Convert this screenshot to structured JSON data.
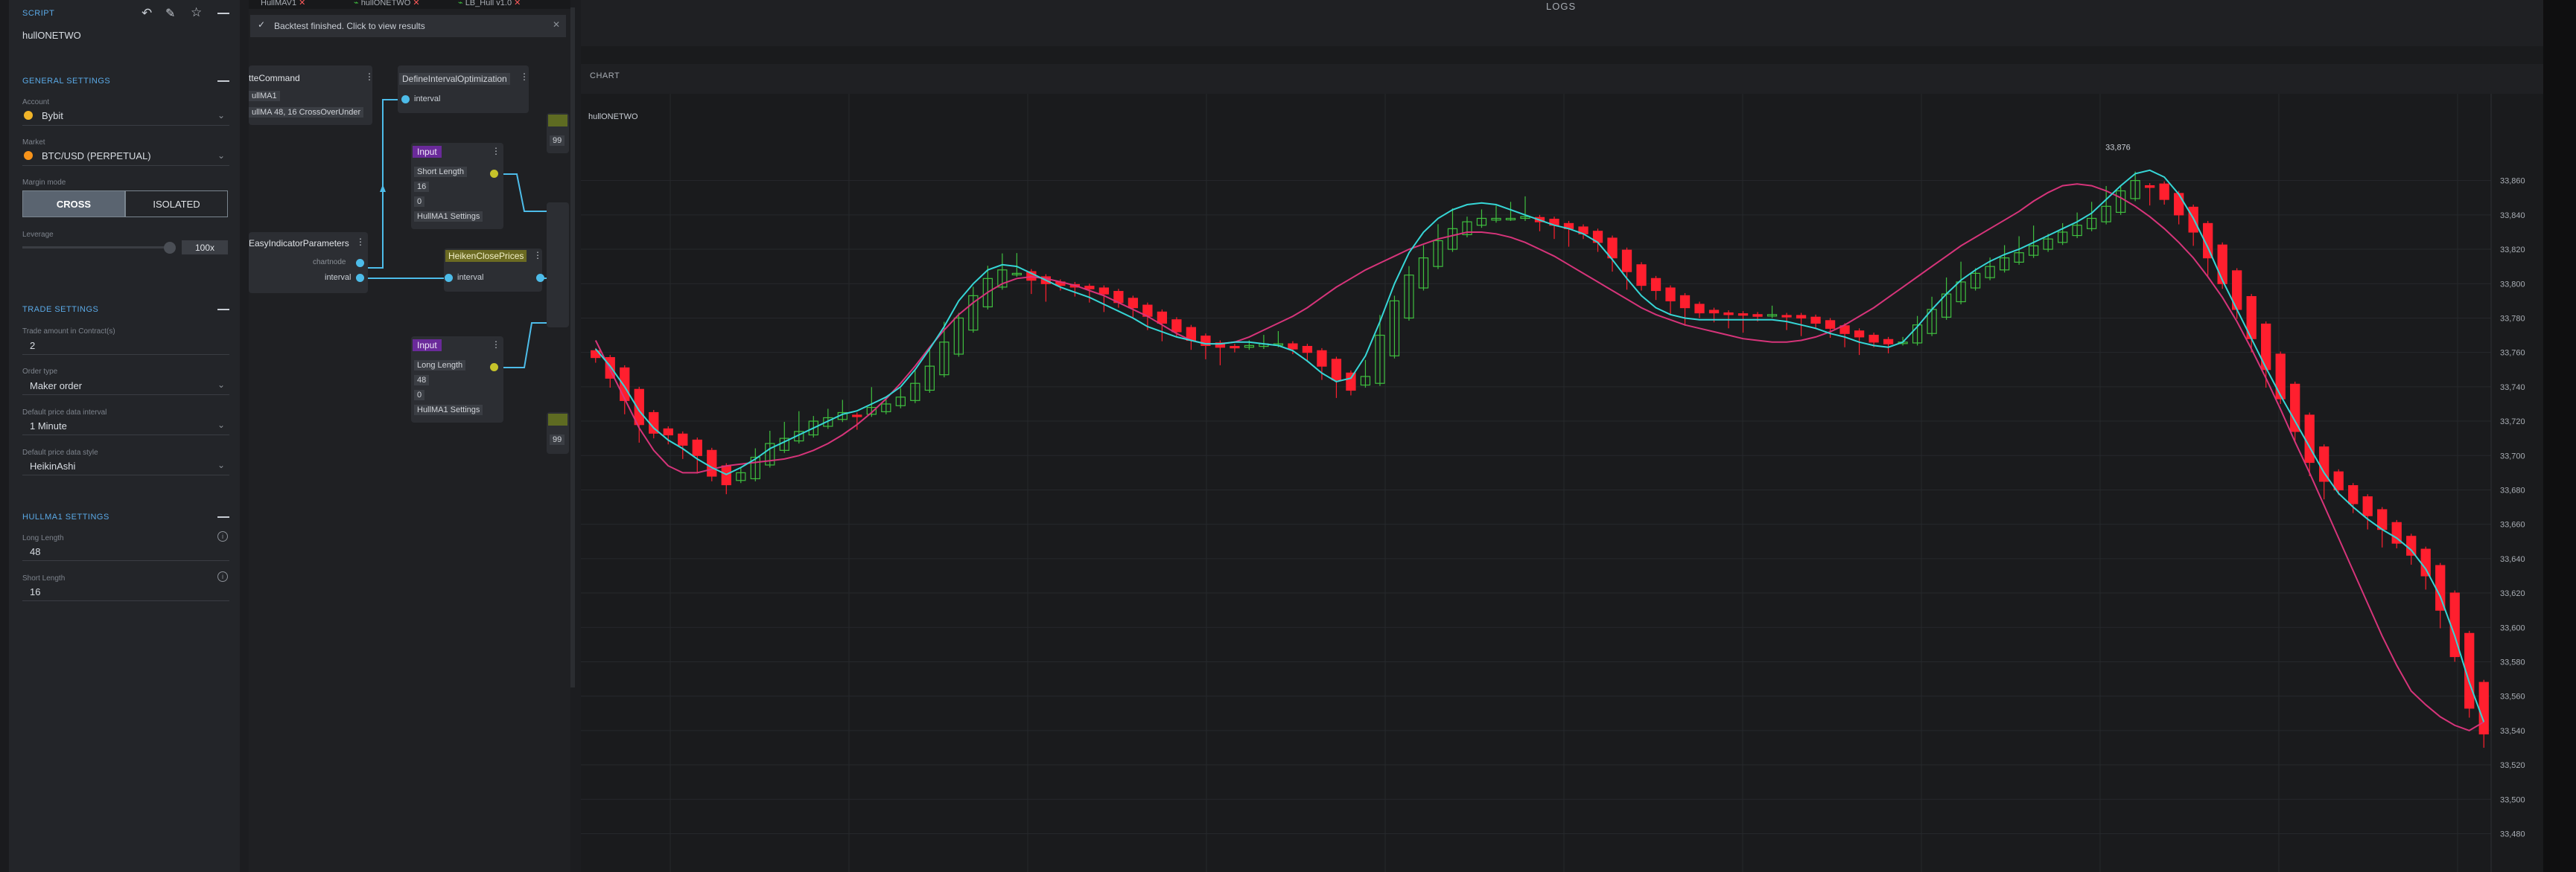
{
  "script": {
    "section_label": "SCRIPT",
    "name": "hullONETWO"
  },
  "general": {
    "title": "GENERAL SETTINGS",
    "account_label": "Account",
    "account_value": "Bybit",
    "market_label": "Market",
    "market_value": "BTC/USD (PERPETUAL)",
    "margin_label": "Margin mode",
    "margin_options": [
      "CROSS",
      "ISOLATED"
    ],
    "margin_selected": "CROSS",
    "leverage_label": "Leverage",
    "leverage_value": "100x"
  },
  "trade": {
    "title": "TRADE SETTINGS",
    "amount_label": "Trade amount in Contract(s)",
    "amount_value": "2",
    "order_type_label": "Order type",
    "order_type_value": "Maker order",
    "interval_label": "Default price data interval",
    "interval_value": "1 Minute",
    "style_label": "Default price data style",
    "style_value": "HeikinAshi"
  },
  "hullma": {
    "title": "HULLMA1 SETTINGS",
    "long_label": "Long Length",
    "long_value": "48",
    "short_label": "Short Length",
    "short_value": "16"
  },
  "tabs": [
    {
      "label": "HullMAV1"
    },
    {
      "label": "hullONETWO"
    },
    {
      "label": "LB_Hull v1.0"
    }
  ],
  "notification": "Backtest finished. Click to view results",
  "nodes": {
    "command_title": "tteCommand",
    "command_param1": "ullMA1",
    "command_param2": "ullMA 48, 16 CrossOverUnder",
    "define_title": "DefineIntervalOptimization",
    "define_port": "interval",
    "input1_title": "Input",
    "input1_name": "Short Length",
    "input1_value": "16",
    "input1_min": "0",
    "input1_group": "HullMA1 Settings",
    "easy_title": "EasyIndicatorParameters",
    "easy_port1": "chartnode",
    "easy_port2": "interval",
    "heiken_title": "HeikenClosePrices",
    "heiken_port": "interval",
    "input2_title": "Input",
    "input2_name": "Long Length",
    "input2_value": "48",
    "input2_min": "0",
    "input2_group": "HullMA1 Settings",
    "side_val1": "99",
    "side_val2": "99"
  },
  "logs_label": "LOGS",
  "chart_label": "CHART",
  "colors": {
    "up": "#3fbf3f",
    "down": "#ff1f2e",
    "hull_fast": "#36d6d6",
    "hull_slow": "#d6347a",
    "accent": "#5aa9e6"
  },
  "chart_data": {
    "type": "candlestick",
    "title": "hullONETWO",
    "y_ticks": [
      "33,860",
      "33,840",
      "33,820",
      "33,800",
      "33,780",
      "33,760",
      "33,740",
      "33,720",
      "33,700",
      "33,680",
      "33,660",
      "33,640",
      "33,620",
      "33,600",
      "33,580",
      "33,560",
      "33,540",
      "33,520",
      "33,500",
      "33,480"
    ],
    "ylim": [
      33475,
      33875
    ],
    "high_label": "33,876",
    "closes": [
      33757,
      33745,
      33732,
      33718,
      33713,
      33712,
      33706,
      33700,
      33688,
      33683,
      33690,
      33699,
      33707,
      33710,
      33714,
      33720,
      33722,
      33725,
      33723,
      33728,
      33730,
      33734,
      33742,
      33752,
      33766,
      33780,
      33793,
      33803,
      33808,
      33806,
      33802,
      33800,
      33799,
      33798,
      33797,
      33794,
      33789,
      33786,
      33781,
      33777,
      33772,
      33767,
      33764,
      33763,
      33763,
      33764,
      33765,
      33765,
      33762,
      33760,
      33752,
      33744,
      33738,
      33746,
      33770,
      33790,
      33805,
      33815,
      33825,
      33832,
      33836,
      33838,
      33838,
      33838,
      33839,
      33836,
      33834,
      33832,
      33829,
      33824,
      33815,
      33807,
      33799,
      33796,
      33790,
      33786,
      33783,
      33783,
      33782,
      33782,
      33781,
      33782,
      33781,
      33780,
      33777,
      33774,
      33771,
      33769,
      33766,
      33765,
      33766,
      33776,
      33785,
      33794,
      33801,
      33806,
      33810,
      33815,
      33818,
      33822,
      33826,
      33830,
      33834,
      33838,
      33845,
      33854,
      33860,
      33856,
      33849,
      33840,
      33830,
      33815,
      33800,
      33785,
      33768,
      33750,
      33733,
      33714,
      33696,
      33685,
      33680,
      33672,
      33665,
      33657,
      33649,
      33642,
      33630,
      33610,
      33583,
      33553,
      33538
    ],
    "hull_fast": [
      33762,
      33752,
      33740,
      33726,
      33716,
      33709,
      33704,
      33698,
      33693,
      33689,
      33693,
      33698,
      33704,
      33708,
      33712,
      33716,
      33720,
      33724,
      33726,
      33730,
      33734,
      33740,
      33750,
      33762,
      33775,
      33790,
      33800,
      33808,
      33811,
      33810,
      33806,
      33802,
      33798,
      33795,
      33792,
      33788,
      33784,
      33780,
      33775,
      33772,
      33769,
      33767,
      33765,
      33765,
      33766,
      33766,
      33765,
      33764,
      33761,
      33755,
      33748,
      33743,
      33745,
      33758,
      33778,
      33800,
      33818,
      33830,
      33838,
      33843,
      33846,
      33847,
      33846,
      33843,
      33840,
      33837,
      33834,
      33832,
      33829,
      33824,
      33814,
      33803,
      33793,
      33786,
      33782,
      33780,
      33779,
      33779,
      33779,
      33779,
      33779,
      33779,
      33778,
      33776,
      33774,
      33771,
      33769,
      33766,
      33764,
      33763,
      33766,
      33775,
      33785,
      33794,
      33802,
      33808,
      33813,
      33817,
      33820,
      33824,
      33828,
      33832,
      33836,
      33841,
      33849,
      33857,
      33864,
      33866,
      33862,
      33852,
      33838,
      33821,
      33802,
      33785,
      33768,
      33751,
      33735,
      33720,
      33705,
      33690,
      33678,
      33670,
      33663,
      33657,
      33652,
      33645,
      33634,
      33618,
      33595,
      33568,
      33545
    ],
    "hull_slow": [
      33767,
      33750,
      33733,
      33716,
      33703,
      33694,
      33690,
      33690,
      33692,
      33694,
      33695,
      33696,
      33697,
      33698,
      33700,
      33703,
      33707,
      33712,
      33718,
      33725,
      33733,
      33742,
      33752,
      33763,
      33773,
      33782,
      33789,
      33795,
      33800,
      33803,
      33804,
      33803,
      33801,
      33799,
      33796,
      33793,
      33789,
      33785,
      33781,
      33776,
      33771,
      33767,
      33765,
      33765,
      33766,
      33769,
      33773,
      33777,
      33781,
      33786,
      33792,
      33798,
      33803,
      33808,
      33812,
      33816,
      33820,
      33823,
      33826,
      33828,
      33830,
      33830,
      33829,
      33827,
      33824,
      33820,
      33816,
      33811,
      33806,
      33801,
      33796,
      33791,
      33786,
      33782,
      33779,
      33776,
      33774,
      33772,
      33770,
      33768,
      33767,
      33766,
      33766,
      33767,
      33769,
      33772,
      33776,
      33781,
      33786,
      33792,
      33798,
      33804,
      33810,
      33816,
      33822,
      33827,
      33832,
      33837,
      33842,
      33848,
      33853,
      33857,
      33858,
      33857,
      33854,
      33850,
      33845,
      33839,
      33832,
      33824,
      33815,
      33804,
      33792,
      33778,
      33762,
      33745,
      33727,
      33708,
      33690,
      33671,
      33652,
      33633,
      33614,
      33595,
      33578,
      33563,
      33555,
      33548,
      33543,
      33540,
      33545
    ]
  }
}
